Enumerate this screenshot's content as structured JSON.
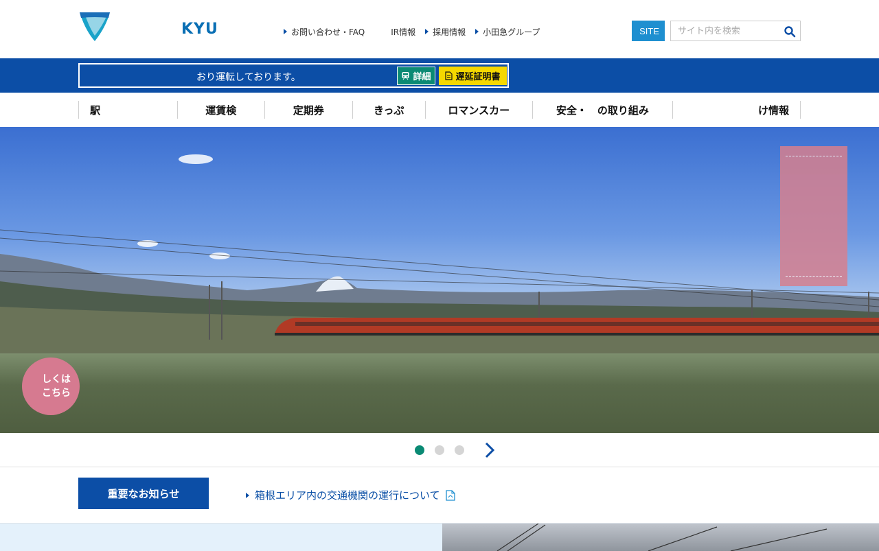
{
  "header": {
    "logo_text": "KYU",
    "utility_links": [
      {
        "label": "お問い合わせ・FAQ"
      },
      {
        "label": "IR情報"
      },
      {
        "label": "採用情報"
      },
      {
        "label": "小田急グループ"
      }
    ],
    "site_button": "SITE",
    "search_placeholder": "サイト内を検索"
  },
  "status": {
    "text": "おり運転しております。",
    "detail_button": "詳細",
    "certificate_button": "遅延証明書"
  },
  "global_nav": [
    {
      "label": "駅"
    },
    {
      "label": "運賃検"
    },
    {
      "label": "定期券"
    },
    {
      "label": "きっぷ"
    },
    {
      "label": "ロマンスカー"
    },
    {
      "label": "安全・　の取り組み"
    },
    {
      "label": "け情報"
    }
  ],
  "hero": {
    "badge_text": "しくは\nこちら"
  },
  "slider": {
    "count": 3,
    "active_index": 0
  },
  "notice": {
    "button": "重要なお知らせ",
    "link_text": "箱根エリア内の交通機関の運行について"
  },
  "colors": {
    "brand_blue": "#0c4ea6",
    "accent_teal": "#0a8a74",
    "accent_yellow": "#f5d800"
  }
}
